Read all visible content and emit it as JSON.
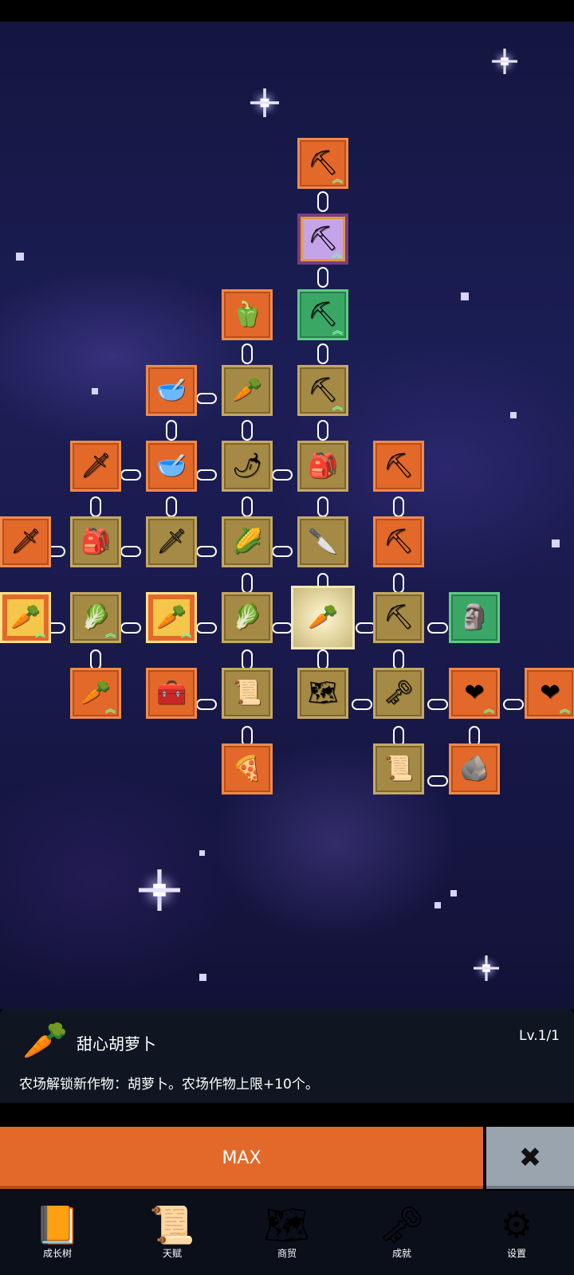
{
  "selected": {
    "icon": "carrot-icon",
    "title": "甜心胡萝卜",
    "level": "Lv.1/1",
    "description": "农场解锁新作物：胡萝卜。农场作物上限+10个。"
  },
  "buttons": {
    "max_label": "MAX",
    "close_icon": "close-icon"
  },
  "nav": [
    {
      "label": "成长树",
      "icon": "book-icon"
    },
    {
      "label": "天赋",
      "icon": "scroll-icon"
    },
    {
      "label": "商贸",
      "icon": "map-icon"
    },
    {
      "label": "成就",
      "icon": "key-icon"
    },
    {
      "label": "设置",
      "icon": "gear-icon"
    }
  ],
  "colors": {
    "orange": "#e2692a",
    "tan": "#a58a45",
    "green": "#3ba767",
    "purple": "#c5a3e8",
    "panel": "#0f1622",
    "nav": "#0b0f1a",
    "close": "#9aa4ae"
  },
  "tree_nodes": [
    {
      "name": "shovel-icon",
      "color": "orange",
      "up": true
    },
    {
      "name": "shovel-icon",
      "color": "purple",
      "up": true
    },
    {
      "name": "pepper-icon",
      "color": "orange",
      "up": false
    },
    {
      "name": "shovel-icon",
      "color": "green",
      "up": true
    },
    {
      "name": "bowl-icon",
      "color": "orange",
      "up": false
    },
    {
      "name": "radish-icon",
      "color": "tan",
      "up": false
    },
    {
      "name": "shovel-icon",
      "color": "tan",
      "up": true
    },
    {
      "name": "sword-icon",
      "color": "orange",
      "up": false
    },
    {
      "name": "bowl-icon",
      "color": "orange",
      "up": false
    },
    {
      "name": "chili-icon",
      "color": "tan",
      "up": false
    },
    {
      "name": "backpack-icon",
      "color": "tan",
      "up": false
    },
    {
      "name": "pickaxe-icon",
      "color": "orange",
      "up": false
    },
    {
      "name": "sword-icon",
      "color": "orange",
      "up": false
    },
    {
      "name": "backpack-icon",
      "color": "tan",
      "up": false
    },
    {
      "name": "sword-icon",
      "color": "tan",
      "up": false
    },
    {
      "name": "corn-icon",
      "color": "tan",
      "up": false
    },
    {
      "name": "knife-icon",
      "color": "tan",
      "up": false
    },
    {
      "name": "pickaxe-icon",
      "color": "orange",
      "up": false
    },
    {
      "name": "carrot-icon",
      "color": "gold",
      "up": true
    },
    {
      "name": "cabbage-icon",
      "color": "tan",
      "up": true
    },
    {
      "name": "carrot-icon",
      "color": "gold",
      "up": true
    },
    {
      "name": "cabbage-icon",
      "color": "tan",
      "up": false
    },
    {
      "name": "carrot-icon",
      "color": "selected",
      "up": false
    },
    {
      "name": "pickaxe-icon",
      "color": "tan",
      "up": false
    },
    {
      "name": "statue-icon",
      "color": "green",
      "up": false
    },
    {
      "name": "carrot-icon",
      "color": "orange",
      "up": true
    },
    {
      "name": "chest-icon",
      "color": "orange",
      "up": false
    },
    {
      "name": "scroll-icon",
      "color": "tan",
      "up": false
    },
    {
      "name": "map-icon",
      "color": "tan",
      "up": false
    },
    {
      "name": "key-icon",
      "color": "tan",
      "up": false
    },
    {
      "name": "heart-icon",
      "color": "orange",
      "up": true
    },
    {
      "name": "heart-icon",
      "color": "orange",
      "up": true
    },
    {
      "name": "pizza-icon",
      "color": "orange",
      "up": false
    },
    {
      "name": "scroll-icon",
      "color": "tan",
      "up": false
    },
    {
      "name": "rock-icon",
      "color": "orange",
      "up": false
    }
  ]
}
